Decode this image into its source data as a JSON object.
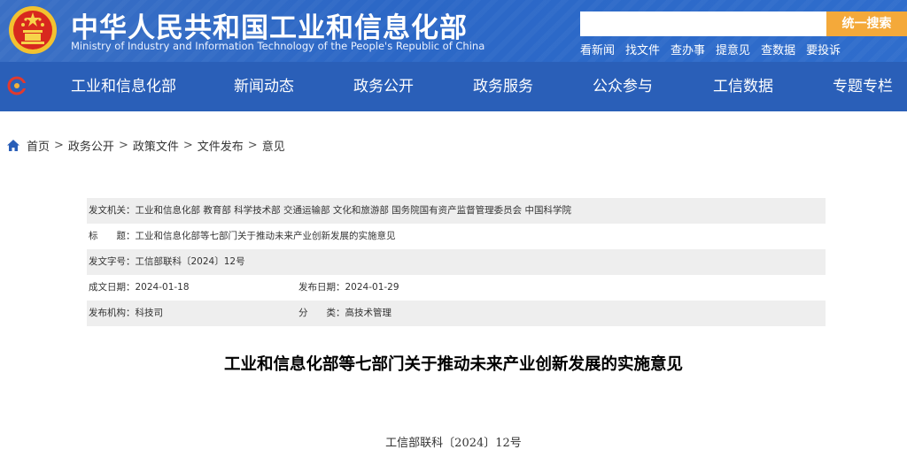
{
  "header": {
    "title": "中华人民共和国工业和信息化部",
    "subtitle": "Ministry of Industry and Information Technology of the People's Republic of China",
    "search_placeholder": "",
    "search_button": "统一搜索",
    "quick_links": [
      "看新闻",
      "找文件",
      "查办事",
      "提意见",
      "查数据",
      "要投诉"
    ]
  },
  "nav": {
    "items": [
      "工业和信息化部",
      "新闻动态",
      "政务公开",
      "政务服务",
      "公众参与",
      "工信数据",
      "专题专栏"
    ]
  },
  "breadcrumb": [
    "首页",
    "政务公开",
    "政策文件",
    "文件发布",
    "意见"
  ],
  "breadcrumb_sep": ">",
  "meta": {
    "issuer_label": "发文机关：",
    "issuer": "工业和信息化部 教育部 科学技术部 交通运输部 文化和旅游部 国务院国有资产监督管理委员会 中国科学院",
    "title_label": "标　　题：",
    "title": "工业和信息化部等七部门关于推动未来产业创新发展的实施意见",
    "doc_no_label": "发文字号：",
    "doc_no": "工信部联科〔2024〕12号",
    "created_label": "成文日期：",
    "created": "2024-01-18",
    "published_label": "发布日期：",
    "published": "2024-01-29",
    "agency_label": "发布机构：",
    "agency": "科技司",
    "category_label": "分　　类：",
    "category": "高技术管理"
  },
  "document": {
    "title": "工业和信息化部等七部门关于推动未来产业创新发展的实施意见",
    "number": "工信部联科〔2024〕12号"
  },
  "colors": {
    "header_blue": "#2b67c6",
    "nav_blue": "#2a5fb8",
    "search_orange": "#f4a93a",
    "row_shade": "#eeeeee"
  }
}
